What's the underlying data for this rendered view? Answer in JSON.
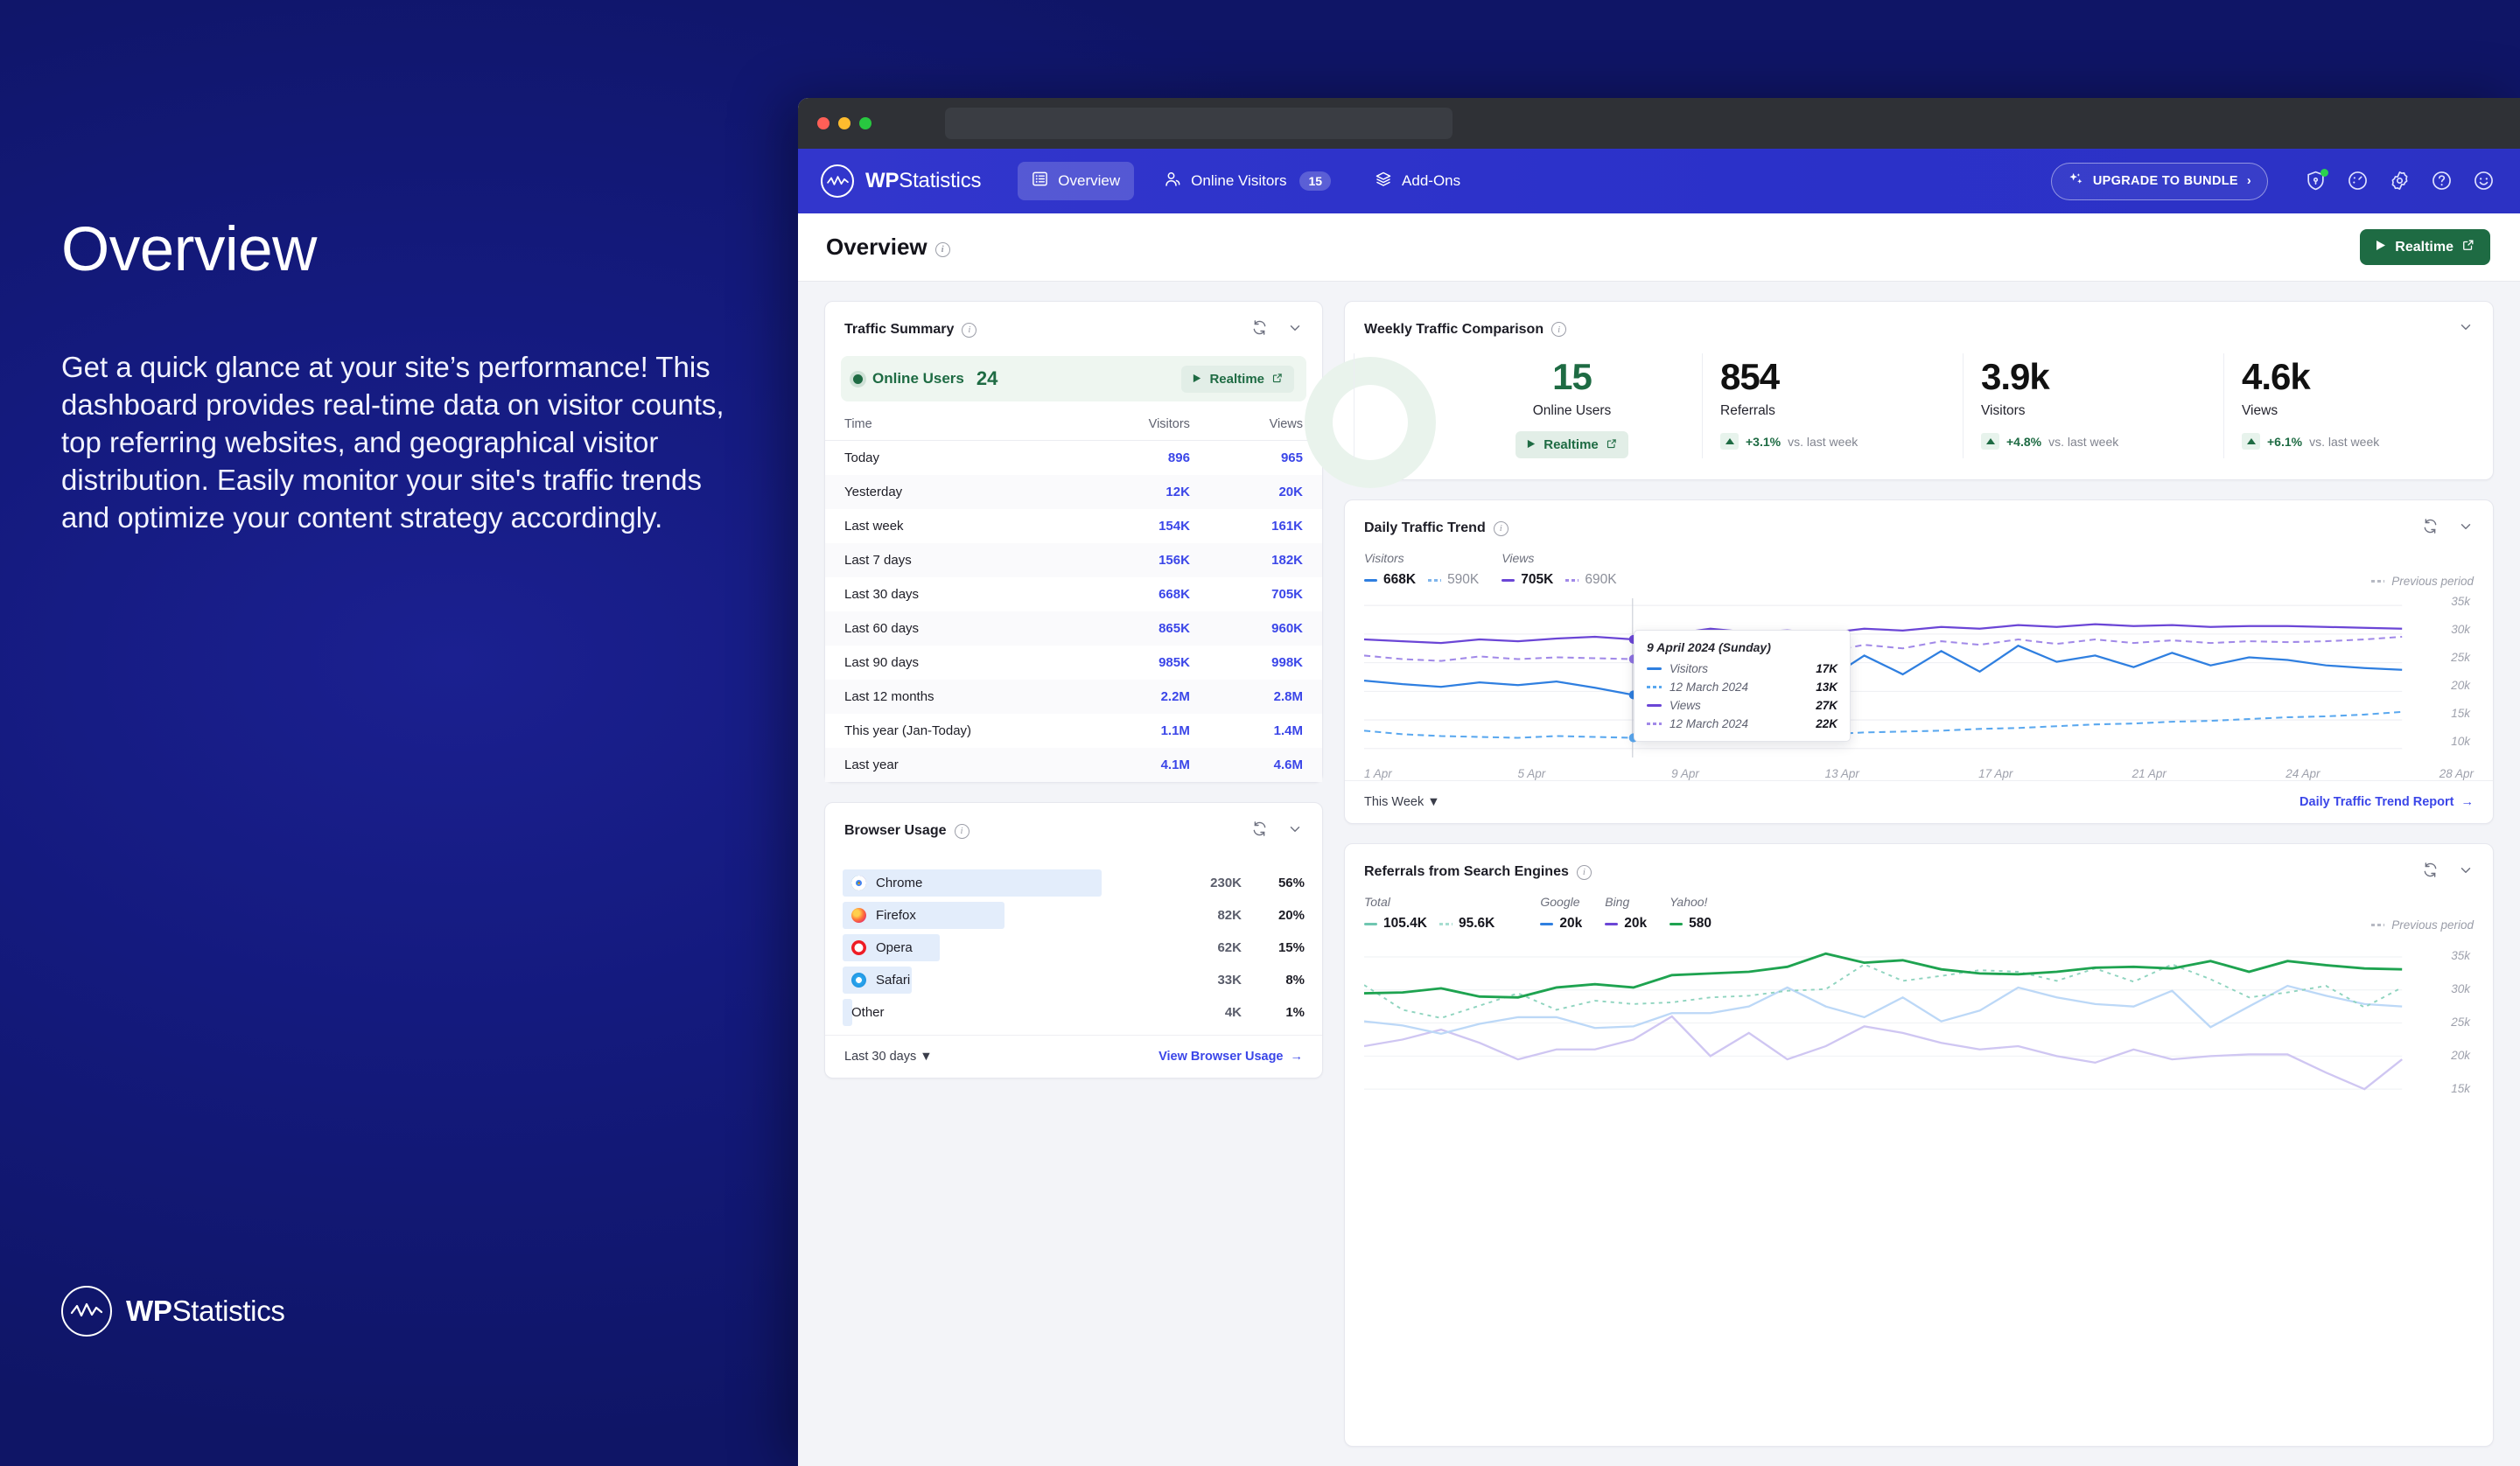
{
  "promo": {
    "title": "Overview",
    "body": "Get a quick glance at your site’s performance! This dashboard provides real-time data on visitor counts, top referring websites, and geographical visitor distribution. Easily monitor your site's traffic trends and optimize your content strategy accordingly.",
    "logo_bold": "WP",
    "logo_rest": "Statistics"
  },
  "nav": {
    "brand_bold": "WP",
    "brand_rest": "Statistics",
    "items": [
      {
        "label": "Overview",
        "icon": "list-icon",
        "active": true,
        "badge": ""
      },
      {
        "label": "Online Visitors",
        "icon": "people-icon",
        "active": false,
        "badge": "15"
      },
      {
        "label": "Add-Ons",
        "icon": "layers-icon",
        "active": false,
        "badge": ""
      }
    ],
    "upgrade_label": "UPGRADE TO BUNDLE",
    "upgrade_chevron": "›",
    "icons": [
      "shield-lock-icon",
      "speedometer-icon",
      "gear-icon",
      "question-circle-icon",
      "smiley-icon"
    ]
  },
  "page": {
    "title": "Overview",
    "realtime_label": "Realtime"
  },
  "traffic_summary": {
    "title": "Traffic Summary",
    "online_label": "Online Users",
    "online_count": "24",
    "realtime_label": "Realtime",
    "columns": [
      "Time",
      "Visitors",
      "Views"
    ],
    "rows": [
      {
        "time": "Today",
        "visitors": "896",
        "views": "965"
      },
      {
        "time": "Yesterday",
        "visitors": "12K",
        "views": "20K"
      },
      {
        "time": "Last week",
        "visitors": "154K",
        "views": "161K"
      },
      {
        "time": "Last 7 days",
        "visitors": "156K",
        "views": "182K"
      },
      {
        "time": "Last 30 days",
        "visitors": "668K",
        "views": "705K"
      },
      {
        "time": "Last 60 days",
        "visitors": "865K",
        "views": "960K"
      },
      {
        "time": "Last 90 days",
        "visitors": "985K",
        "views": "998K"
      },
      {
        "time": "Last 12 months",
        "visitors": "2.2M",
        "views": "2.8M"
      },
      {
        "time": "This year (Jan-Today)",
        "visitors": "1.1M",
        "views": "1.4M"
      },
      {
        "time": "Last year",
        "visitors": "4.1M",
        "views": "4.6M"
      }
    ]
  },
  "browser_usage": {
    "title": "Browser Usage",
    "period_label": "Last 30 days",
    "view_link": "View Browser Usage",
    "rows": [
      {
        "name": "Chrome",
        "value": "230K",
        "percent": "56%",
        "bar": 56,
        "color": "#e8b21f"
      },
      {
        "name": "Firefox",
        "value": "82K",
        "percent": "20%",
        "bar": 35,
        "color": "#f37021"
      },
      {
        "name": "Opera",
        "value": "62K",
        "percent": "15%",
        "bar": 21,
        "color": "#ee1c25"
      },
      {
        "name": "Safari",
        "value": "33K",
        "percent": "8%",
        "bar": 15,
        "color": "#2aa7f0"
      },
      {
        "name": "Other",
        "value": "4K",
        "percent": "1%",
        "bar": 2,
        "color": "#c9ccd6"
      }
    ]
  },
  "weekly_traffic": {
    "title": "Weekly Traffic Comparison",
    "cells": [
      {
        "value": "15",
        "label": "Online Users",
        "delta": "",
        "delta_note": "",
        "realtime_label": "Realtime"
      },
      {
        "value": "854",
        "label": "Referrals",
        "delta": "+3.1%",
        "delta_note": "vs. last week"
      },
      {
        "value": "3.9k",
        "label": "Visitors",
        "delta": "+4.8%",
        "delta_note": "vs. last week"
      },
      {
        "value": "4.6k",
        "label": "Views",
        "delta": "+6.1%",
        "delta_note": "vs. last week"
      }
    ]
  },
  "daily_traffic_trend": {
    "title": "Daily Traffic Trend",
    "legend": [
      {
        "head": "Visitors",
        "current": "668K",
        "previous": "590K",
        "color": "#2f7fe0"
      },
      {
        "head": "Views",
        "current": "705K",
        "previous": "690K",
        "color": "#6b46d6"
      }
    ],
    "previous_period_label": "Previous period",
    "period_label": "This Week",
    "report_link": "Daily Traffic Trend Report",
    "tooltip": {
      "title": "9 April 2024 (Sunday)",
      "rows": [
        {
          "label": "Visitors",
          "value": "17K",
          "style": "solid",
          "color": "#2f7fe0"
        },
        {
          "label": "12 March 2024",
          "value": "13K",
          "style": "dashed",
          "color": "#2f7fe0"
        },
        {
          "label": "Views",
          "value": "27K",
          "style": "solid",
          "color": "#6b46d6"
        },
        {
          "label": "12 March 2024",
          "value": "22K",
          "style": "dashed",
          "color": "#6b46d6"
        }
      ]
    }
  },
  "referrals_search": {
    "title": "Referrals from Search Engines",
    "previous_period_label": "Previous period",
    "legend": [
      {
        "head": "Total",
        "current": "105.4K",
        "previous": "95.6K",
        "color": "#6fc6b0"
      },
      {
        "head": "Google",
        "current": "20k",
        "color": "#2f7fe0"
      },
      {
        "head": "Bing",
        "current": "20k",
        "color": "#6b46d6"
      },
      {
        "head": "Yahoo!",
        "current": "580",
        "color": "#1ea350"
      }
    ]
  },
  "chart_data": [
    {
      "type": "line",
      "title": "Daily Traffic Trend",
      "xlabel": "",
      "ylabel": "",
      "ylim": [
        5000,
        37000
      ],
      "yticks": [
        "10k",
        "15k",
        "20k",
        "25k",
        "30k",
        "35k"
      ],
      "xticks": [
        "1 Apr",
        "5 Apr",
        "9 Apr",
        "13 Apr",
        "17 Apr",
        "21 Apr",
        "24 Apr",
        "28 Apr"
      ],
      "x": [
        "1 Apr",
        "2 Apr",
        "3 Apr",
        "4 Apr",
        "5 Apr",
        "6 Apr",
        "7 Apr",
        "8 Apr",
        "9 Apr",
        "10 Apr",
        "11 Apr",
        "12 Apr",
        "13 Apr",
        "14 Apr",
        "15 Apr",
        "16 Apr",
        "17 Apr",
        "18 Apr",
        "19 Apr",
        "20 Apr",
        "21 Apr",
        "22 Apr",
        "23 Apr",
        "24 Apr",
        "25 Apr",
        "26 Apr",
        "27 Apr",
        "28 Apr"
      ],
      "series": [
        {
          "name": "Visitors",
          "style": "solid",
          "color": "#2f7fe0",
          "values": [
            19000,
            18200,
            17600,
            18500,
            17900,
            18600,
            17300,
            15800,
            17000,
            21500,
            18400,
            22500,
            19000,
            24500,
            20500,
            25500,
            21000,
            26500,
            23000,
            24500,
            22000,
            25000,
            22500,
            24000,
            23500,
            22500,
            22000,
            21500
          ]
        },
        {
          "name": "12 March 2024",
          "style": "dashed",
          "color": "#5aa8ef",
          "values": [
            11500,
            10800,
            10500,
            10300,
            10200,
            10500,
            10400,
            10200,
            10000,
            10300,
            10400,
            10600,
            10800,
            11000,
            11200,
            11500,
            11700,
            11900,
            12200,
            12500,
            12700,
            12900,
            13100,
            13400,
            13600,
            13800,
            14100,
            14500
          ]
        },
        {
          "name": "Views",
          "style": "solid",
          "color": "#6b46d6",
          "values": [
            25500,
            25000,
            24500,
            25500,
            25000,
            25800,
            26200,
            25500,
            27000,
            28500,
            27500,
            28000,
            27200,
            28500,
            28000,
            29000,
            28500,
            29500,
            29000,
            29800,
            29200,
            29600,
            29000,
            29400,
            29200,
            29000,
            28800,
            28500
          ]
        },
        {
          "name": "12 March 2024 (views)",
          "style": "dashed",
          "color": "#9b7ce6",
          "values": [
            22500,
            22000,
            21800,
            22300,
            22000,
            22400,
            22200,
            22000,
            22000,
            23000,
            22500,
            23500,
            23000,
            24000,
            23500,
            24500,
            24000,
            24800,
            24200,
            24800,
            24300,
            24700,
            24300,
            24600,
            24400,
            24600,
            24800,
            25200
          ]
        }
      ]
    },
    {
      "type": "line",
      "title": "Referrals from Search Engines",
      "ylim": [
        12000,
        37000
      ],
      "yticks": [
        "15k",
        "20k",
        "25k",
        "30k",
        "35k"
      ],
      "series": [
        {
          "name": "Total",
          "style": "solid",
          "color": "#1ea350",
          "values": [
            29000,
            29200,
            29800,
            28500,
            28400,
            30000,
            30500,
            30000,
            32000,
            32200,
            32500,
            33200,
            35200,
            33800,
            34200,
            32800,
            32200,
            32000,
            32400,
            33100,
            33200,
            33000,
            34200,
            32500,
            34100,
            33500,
            33000,
            32900
          ]
        },
        {
          "name": "Total previous",
          "style": "dotted",
          "color": "#6fc6b0",
          "values": [
            30300,
            26500,
            25200,
            27200,
            29000,
            26500,
            28000,
            27500,
            27800,
            28500,
            28800,
            29500,
            29800,
            33500,
            31000,
            31800,
            32700,
            32500,
            31000,
            32900,
            30800,
            33500,
            31300,
            28500,
            29300,
            30300,
            27000,
            30000
          ]
        },
        {
          "name": "Google",
          "style": "solid",
          "color": "#bcd8f7",
          "values": [
            24800,
            24200,
            23000,
            24500,
            25500,
            25500,
            23800,
            24000,
            26000,
            26000,
            27000,
            29800,
            27000,
            25500,
            28500,
            24800,
            26500,
            30000,
            28500,
            27500,
            27000,
            29500,
            24000,
            27000,
            30200,
            28800,
            27500,
            27000
          ]
        },
        {
          "name": "Bing",
          "style": "solid",
          "color": "#cfc6f2",
          "values": [
            21000,
            22000,
            23500,
            21500,
            19000,
            20500,
            20500,
            22000,
            25500,
            19500,
            23000,
            19000,
            21000,
            24000,
            23000,
            21500,
            20500,
            21000,
            19500,
            18500,
            20500,
            19000,
            19500,
            19800,
            19800,
            17000,
            14500,
            19200
          ]
        }
      ]
    }
  ]
}
